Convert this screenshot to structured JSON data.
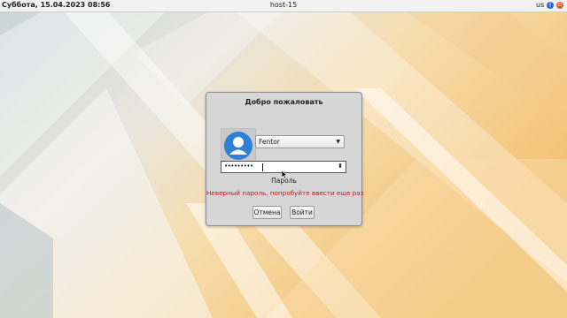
{
  "topbar": {
    "datetime": "Суббота, 15.04.2023 08:56",
    "hostname": "host-15",
    "keyboard_layout": "us",
    "bluetooth_icon": "bluetooth-icon",
    "power_icon": "power-icon"
  },
  "dialog": {
    "title": "Добро пожаловать",
    "user_select": {
      "selected": "Fentor",
      "arrow_icon": "chevron-down-icon"
    },
    "password_field": {
      "value": "•••••••••",
      "spin_icon": "spinner-arrows-icon"
    },
    "password_label": "Пароль",
    "error_message": "Неверный пароль, попробуйте ввести еще раз",
    "buttons": {
      "cancel": "Отмена",
      "login": "Войти"
    },
    "avatar_icon": "user-avatar-icon"
  },
  "colors": {
    "error": "#c31818",
    "avatar": "#2f7fd6",
    "wallpaper_warm": "#f2c27a",
    "wallpaper_cool": "#cfd9de"
  }
}
